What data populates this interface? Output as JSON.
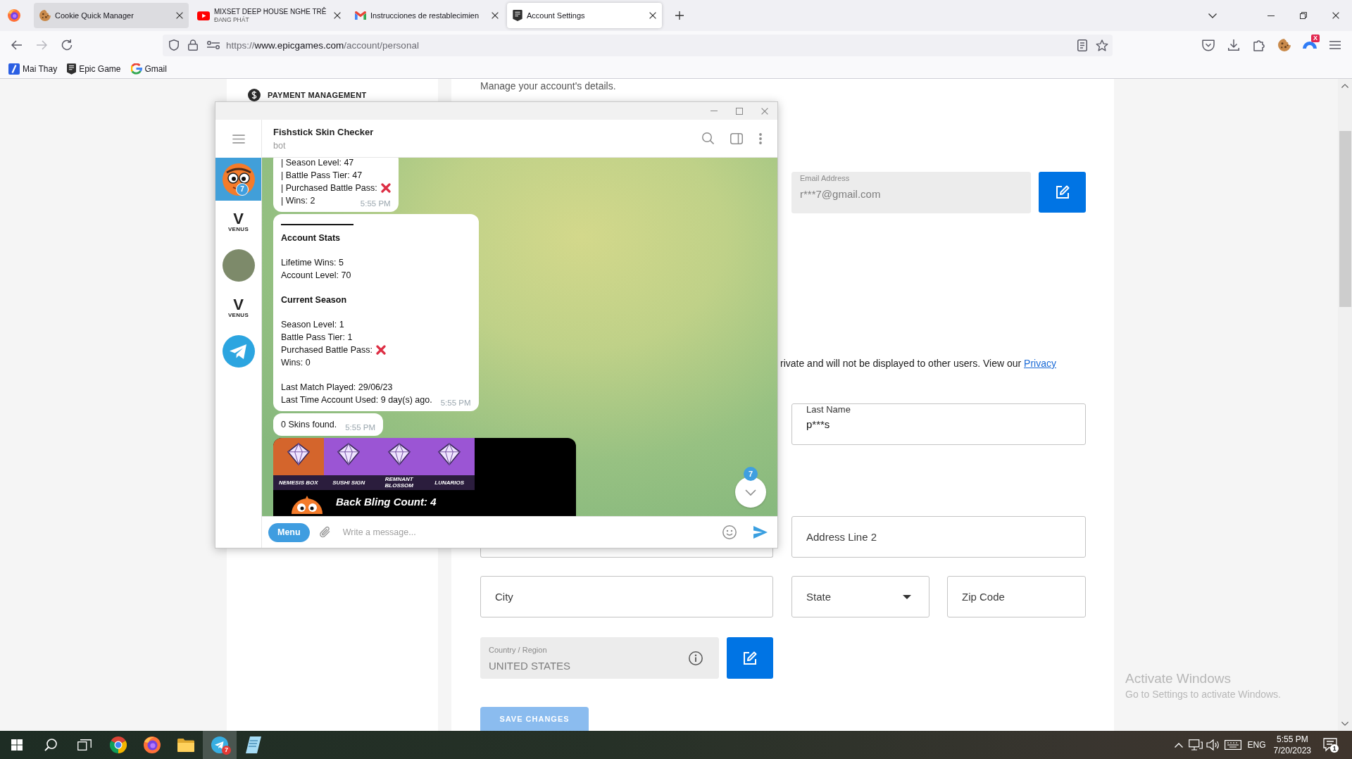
{
  "browser": {
    "tabs": [
      {
        "kind": "cookie",
        "title": "Cookie Quick Manager",
        "selected": false,
        "hovered": true
      },
      {
        "kind": "youtube",
        "title": "MIXSET DEEP HOUSE NGHE TRÊ",
        "subtitle": "ĐANG PHÁT",
        "selected": false,
        "hovered": false
      },
      {
        "kind": "gmail",
        "title": "Instrucciones de restablecimien",
        "selected": false,
        "hovered": false
      },
      {
        "kind": "epic",
        "title": "Account Settings",
        "selected": true,
        "hovered": false
      }
    ],
    "nav": [
      {
        "kind": "back",
        "disabled": false
      },
      {
        "kind": "forward",
        "disabled": true
      },
      {
        "kind": "reload",
        "disabled": false
      }
    ],
    "url": {
      "scheme": "https://",
      "host": "www.epicgames.com",
      "path": "/account/personal"
    },
    "toolbar": [
      {
        "kind": "pocket"
      },
      {
        "kind": "download"
      },
      {
        "kind": "extensions"
      },
      {
        "kind": "cookie"
      },
      {
        "kind": "arch",
        "badge": "X"
      },
      {
        "kind": "menu"
      }
    ],
    "bookmarks": [
      {
        "kind": "slash",
        "label": "Mai Thay"
      },
      {
        "kind": "epic",
        "label": "Epic Game"
      },
      {
        "kind": "google",
        "label": "Gmail"
      }
    ]
  },
  "page": {
    "intro": "Manage your account's details.",
    "sidebar": {
      "items": [
        {
          "kind": "payment",
          "label": "PAYMENT MANAGEMENT"
        }
      ]
    },
    "form": {
      "email": {
        "label": "Email Address",
        "value": "r***7@gmail.com",
        "disabled": true
      },
      "privacy_note": {
        "text": "rivate and will not be displayed to other users. View our",
        "link": "Privacy"
      },
      "last_name": {
        "label": "Last Name",
        "value": "p***s",
        "disabled": false
      },
      "address_line_2": {
        "placeholder": "Address Line 2",
        "disabled": false
      },
      "city": {
        "placeholder": "City",
        "disabled": false
      },
      "state": {
        "placeholder": "State",
        "disabled": false
      },
      "zip_code": {
        "placeholder": "Zip Code",
        "disabled": false
      },
      "country": {
        "label": "Country / Region",
        "value": "UNITED STATES",
        "disabled": true
      },
      "save_button": {
        "label": "SAVE CHANGES",
        "disabled": true
      }
    }
  },
  "telegram": {
    "chat": {
      "title": "Fishstick Skin Checker",
      "subtitle": "bot"
    },
    "chats": [
      {
        "kind": "fish",
        "selected": true,
        "badge": "7"
      },
      {
        "kind": "logo",
        "mark": "V",
        "label": "VENUS",
        "selected": false
      },
      {
        "kind": "photo",
        "selected": false
      },
      {
        "kind": "logo",
        "mark": "V",
        "label": "VENUS",
        "selected": false
      },
      {
        "kind": "plane",
        "selected": false
      }
    ],
    "messages": [
      {
        "kind": "text",
        "time": "5:55 PM",
        "blocks": [
          {
            "kind": "lines",
            "lines": [
              {
                "text": "| Season Level: 47",
                "cross": false
              },
              {
                "text": "| Battle Pass Tier: 47",
                "cross": false
              },
              {
                "text": "| Purchased Battle Pass:",
                "cross": true
              },
              {
                "text": "| Wins: 2",
                "cross": false
              }
            ]
          }
        ]
      },
      {
        "kind": "text",
        "time": "5:55 PM",
        "blocks": [
          {
            "kind": "rule"
          },
          {
            "kind": "heading",
            "text": "Account Stats"
          },
          {
            "kind": "lines",
            "lines": [
              {
                "text": "Lifetime Wins: 5",
                "cross": false
              },
              {
                "text": "Account Level: 70",
                "cross": false
              }
            ]
          },
          {
            "kind": "heading",
            "text": "Current Season"
          },
          {
            "kind": "lines",
            "lines": [
              {
                "text": "Season Level: 1",
                "cross": false
              },
              {
                "text": "Battle Pass Tier: 1",
                "cross": false
              },
              {
                "text": "Purchased Battle Pass:",
                "cross": true
              },
              {
                "text": "Wins: 0",
                "cross": false
              }
            ]
          },
          {
            "kind": "lines",
            "lines": [
              {
                "text": "Last Match Played: 29/06/23",
                "cross": false
              },
              {
                "text": "Last Time Account Used: 9 day(s) ago.",
                "cross": false
              }
            ]
          }
        ]
      },
      {
        "kind": "text",
        "time": "5:55 PM",
        "blocks": [
          {
            "kind": "lines",
            "lines": [
              {
                "text": "0 Skins found.",
                "cross": false
              }
            ]
          }
        ]
      },
      {
        "kind": "image",
        "tiles": [
          {
            "label": "NEMESIS BOX",
            "color": "#d4652c"
          },
          {
            "label": "SUSHI SIGN",
            "color": "#9b55d4"
          },
          {
            "label": "REMNANT BLOSSOM",
            "color": "#9b55d4"
          },
          {
            "label": "LUNARIOS",
            "color": "#9b55d4"
          }
        ],
        "caption": "Back Bling Count: 4"
      }
    ],
    "scroll_badge": "7",
    "composer": {
      "menu": "Menu",
      "placeholder": "Write a message..."
    }
  },
  "activation": {
    "title": "Activate Windows",
    "subtitle": "Go to Settings to activate Windows."
  },
  "taskbar": {
    "apps": [
      {
        "kind": "chrome",
        "active": false
      },
      {
        "kind": "firefox",
        "active": false
      },
      {
        "kind": "folder",
        "active": false
      },
      {
        "kind": "telegram",
        "active": true,
        "badge": "7"
      },
      {
        "kind": "notepad",
        "active": false
      }
    ],
    "language": "ENG",
    "time": "5:55 PM",
    "date": "7/20/2023",
    "notifications": "1"
  }
}
